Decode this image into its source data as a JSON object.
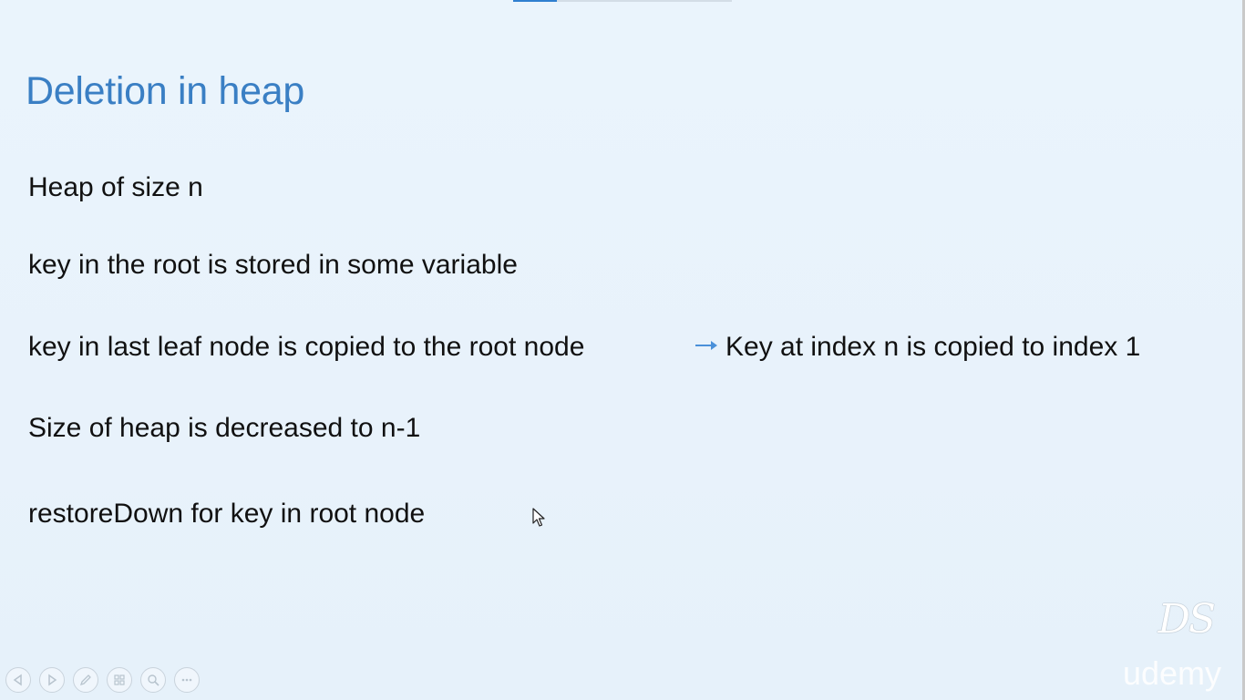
{
  "slide": {
    "title": "Deletion in heap",
    "bullets": [
      "Heap of size n",
      "key in the root is stored in some variable",
      "key in last leaf node is copied to the root node",
      "Size of heap is decreased to n-1",
      "restoreDown for key in root node"
    ],
    "note": "Key at index n is copied to index 1",
    "progress": 0.2
  },
  "watermarks": {
    "logo": "DS",
    "brand": "udemy"
  },
  "controls": [
    {
      "name": "previous-slide-icon"
    },
    {
      "name": "next-slide-icon"
    },
    {
      "name": "pen-icon"
    },
    {
      "name": "slides-grid-icon"
    },
    {
      "name": "zoom-icon"
    },
    {
      "name": "more-options-icon"
    }
  ],
  "colors": {
    "title": "#3a7fc4",
    "text": "#111111",
    "arrow": "#4a90d9",
    "background": "#e9f3fb"
  }
}
